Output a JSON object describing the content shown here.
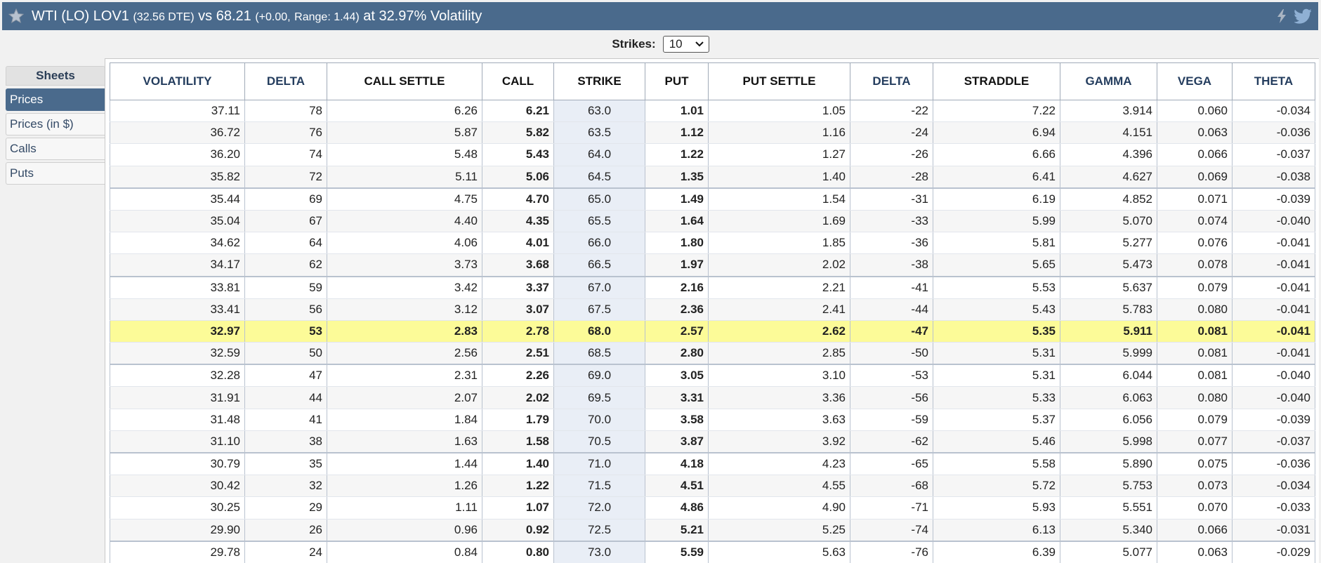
{
  "title": {
    "main": "WTI (LO) LOV1",
    "dte": "(32.56 DTE)",
    "vs": "vs 68.21",
    "change": "(+0.00,",
    "range": "Range: 1.44)",
    "volatility": "at 32.97% Volatility"
  },
  "strikes": {
    "label": "Strikes:",
    "value": "10"
  },
  "sidebar": {
    "header": "Sheets",
    "items": [
      {
        "label": "Prices",
        "active": true
      },
      {
        "label": "Prices (in $)",
        "active": false
      },
      {
        "label": "Calls",
        "active": false
      },
      {
        "label": "Puts",
        "active": false
      }
    ]
  },
  "table": {
    "headers": [
      "VOLATILITY",
      "DELTA",
      "CALL SETTLE",
      "CALL",
      "STRIKE",
      "PUT",
      "PUT SETTLE",
      "DELTA",
      "STRADDLE",
      "GAMMA",
      "VEGA",
      "THETA"
    ],
    "highlight_strike": "68.0",
    "rows": [
      [
        "37.11",
        "78",
        "6.26",
        "6.21",
        "63.0",
        "1.01",
        "1.05",
        "-22",
        "7.22",
        "3.914",
        "0.060",
        "-0.034"
      ],
      [
        "36.72",
        "76",
        "5.87",
        "5.82",
        "63.5",
        "1.12",
        "1.16",
        "-24",
        "6.94",
        "4.151",
        "0.063",
        "-0.036"
      ],
      [
        "36.20",
        "74",
        "5.48",
        "5.43",
        "64.0",
        "1.22",
        "1.27",
        "-26",
        "6.66",
        "4.396",
        "0.066",
        "-0.037"
      ],
      [
        "35.82",
        "72",
        "5.11",
        "5.06",
        "64.5",
        "1.35",
        "1.40",
        "-28",
        "6.41",
        "4.627",
        "0.069",
        "-0.038"
      ],
      [
        "35.44",
        "69",
        "4.75",
        "4.70",
        "65.0",
        "1.49",
        "1.54",
        "-31",
        "6.19",
        "4.852",
        "0.071",
        "-0.039"
      ],
      [
        "35.04",
        "67",
        "4.40",
        "4.35",
        "65.5",
        "1.64",
        "1.69",
        "-33",
        "5.99",
        "5.070",
        "0.074",
        "-0.040"
      ],
      [
        "34.62",
        "64",
        "4.06",
        "4.01",
        "66.0",
        "1.80",
        "1.85",
        "-36",
        "5.81",
        "5.277",
        "0.076",
        "-0.041"
      ],
      [
        "34.17",
        "62",
        "3.73",
        "3.68",
        "66.5",
        "1.97",
        "2.02",
        "-38",
        "5.65",
        "5.473",
        "0.078",
        "-0.041"
      ],
      [
        "33.81",
        "59",
        "3.42",
        "3.37",
        "67.0",
        "2.16",
        "2.21",
        "-41",
        "5.53",
        "5.637",
        "0.079",
        "-0.041"
      ],
      [
        "33.41",
        "56",
        "3.12",
        "3.07",
        "67.5",
        "2.36",
        "2.41",
        "-44",
        "5.43",
        "5.783",
        "0.080",
        "-0.041"
      ],
      [
        "32.97",
        "53",
        "2.83",
        "2.78",
        "68.0",
        "2.57",
        "2.62",
        "-47",
        "5.35",
        "5.911",
        "0.081",
        "-0.041"
      ],
      [
        "32.59",
        "50",
        "2.56",
        "2.51",
        "68.5",
        "2.80",
        "2.85",
        "-50",
        "5.31",
        "5.999",
        "0.081",
        "-0.041"
      ],
      [
        "32.28",
        "47",
        "2.31",
        "2.26",
        "69.0",
        "3.05",
        "3.10",
        "-53",
        "5.31",
        "6.044",
        "0.081",
        "-0.040"
      ],
      [
        "31.91",
        "44",
        "2.07",
        "2.02",
        "69.5",
        "3.31",
        "3.36",
        "-56",
        "5.33",
        "6.063",
        "0.080",
        "-0.040"
      ],
      [
        "31.48",
        "41",
        "1.84",
        "1.79",
        "70.0",
        "3.58",
        "3.63",
        "-59",
        "5.37",
        "6.056",
        "0.079",
        "-0.039"
      ],
      [
        "31.10",
        "38",
        "1.63",
        "1.58",
        "70.5",
        "3.87",
        "3.92",
        "-62",
        "5.46",
        "5.998",
        "0.077",
        "-0.037"
      ],
      [
        "30.79",
        "35",
        "1.44",
        "1.40",
        "71.0",
        "4.18",
        "4.23",
        "-65",
        "5.58",
        "5.890",
        "0.075",
        "-0.036"
      ],
      [
        "30.42",
        "32",
        "1.26",
        "1.22",
        "71.5",
        "4.51",
        "4.55",
        "-68",
        "5.72",
        "5.753",
        "0.073",
        "-0.034"
      ],
      [
        "30.25",
        "29",
        "1.11",
        "1.07",
        "72.0",
        "4.86",
        "4.90",
        "-71",
        "5.93",
        "5.551",
        "0.070",
        "-0.033"
      ],
      [
        "29.90",
        "26",
        "0.96",
        "0.92",
        "72.5",
        "5.21",
        "5.25",
        "-74",
        "6.13",
        "5.340",
        "0.066",
        "-0.031"
      ],
      [
        "29.78",
        "24",
        "0.84",
        "0.80",
        "73.0",
        "5.59",
        "5.63",
        "-76",
        "6.39",
        "5.077",
        "0.063",
        "-0.029"
      ]
    ]
  },
  "colors": {
    "header_bar": "#4a6a8c",
    "highlight_row": "#fcfb98",
    "strike_column": "#e9eef6"
  }
}
